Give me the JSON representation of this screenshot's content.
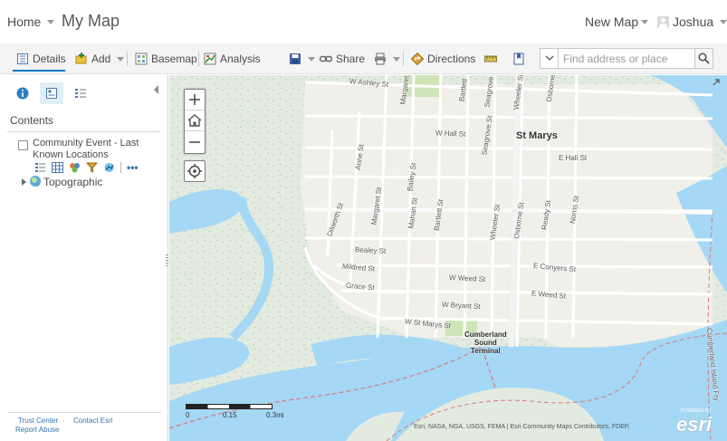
{
  "header": {
    "home_label": "Home",
    "map_title": "My Map",
    "new_map_label": "New Map",
    "user_name": "Joshua"
  },
  "toolbar": {
    "details_label": "Details",
    "add_label": "Add",
    "basemap_label": "Basemap",
    "analysis_label": "Analysis",
    "share_label": "Share",
    "directions_label": "Directions",
    "search_placeholder": "Find address or place"
  },
  "panel": {
    "contents_heading": "Contents",
    "layers": [
      {
        "name": "Community Event - Last Known Locations",
        "checked": false
      },
      {
        "name": "Topographic",
        "type": "basemap"
      }
    ],
    "more_label": "•••",
    "footer_links": [
      "Trust Center",
      "Contact Esri",
      "Report Abuse"
    ]
  },
  "map": {
    "city_label": "St Marys",
    "terminal_label": [
      "Cumberland",
      "Sound",
      "Terminal"
    ],
    "streets": [
      "W Ashley St",
      "Margaret",
      "Bartlett",
      "Seagrove",
      "Wheeler St",
      "Osborne",
      "W Hall St",
      "Seagrove St",
      "E Hall St",
      "Anne St",
      "Bailey St",
      "Dilworth St",
      "Margaret St",
      "Mahan St",
      "Bartlett St",
      "Wheeler St",
      "Osborne St",
      "Ready St",
      "Norris St",
      "Bealey St",
      "E Conyers St",
      "Mildred St",
      "W Weed St",
      "E Weed St",
      "Grace St",
      "W Bryant St",
      "W St Marys St",
      "Cumberland Island Fry"
    ],
    "scale_labels": [
      "0",
      "0.15",
      "0.3mi"
    ],
    "attribution": "Esri, NASA, NGA, USGS, FEMA | Esri Community Maps Contributors, FDEP,",
    "esri_powered_label": "POWERED BY",
    "esri_logo_text": "esri"
  },
  "colors": {
    "accent": "#0079c1",
    "water": "#a5d8f5",
    "land": "#e6ebe1",
    "park": "#cfe5b8"
  }
}
